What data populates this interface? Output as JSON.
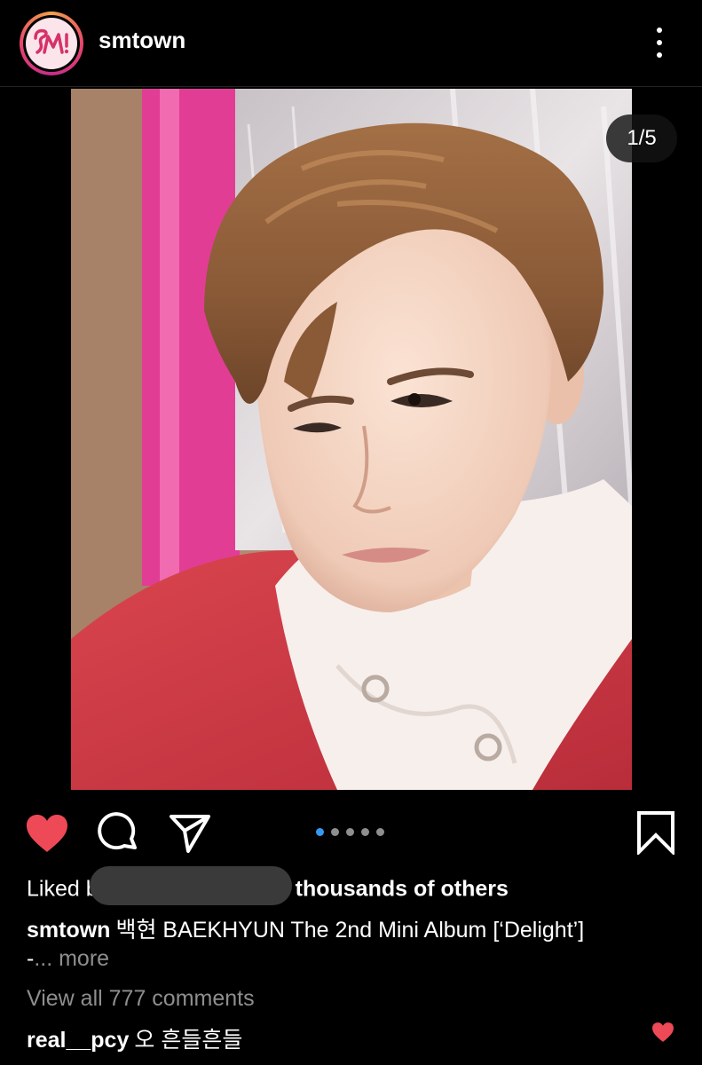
{
  "header": {
    "username": "smtown",
    "avatar_logo_text": "SM!",
    "more_icon": "more-vertical-icon"
  },
  "post": {
    "image_counter": "1/5",
    "carousel_total": 5,
    "carousel_active_index": 0
  },
  "actions": {
    "like_icon": "heart-filled-icon",
    "comment_icon": "comment-bubble-icon",
    "share_icon": "paper-plane-icon",
    "save_icon": "bookmark-icon",
    "liked_color": "#ed4956",
    "dot_active_color": "#3897f0"
  },
  "likes": {
    "prefix": "Liked b",
    "suffix": "thousands of others"
  },
  "caption": {
    "username": "smtown",
    "text": "백현 BAEKHYUN The 2nd Mini Album [‘Delight’]",
    "continuation": "-",
    "more_label": "... more"
  },
  "comments": {
    "view_all_label": "View all 777 comments",
    "items": [
      {
        "username": "real__pcy",
        "text": "오 흔들흔들"
      }
    ]
  }
}
